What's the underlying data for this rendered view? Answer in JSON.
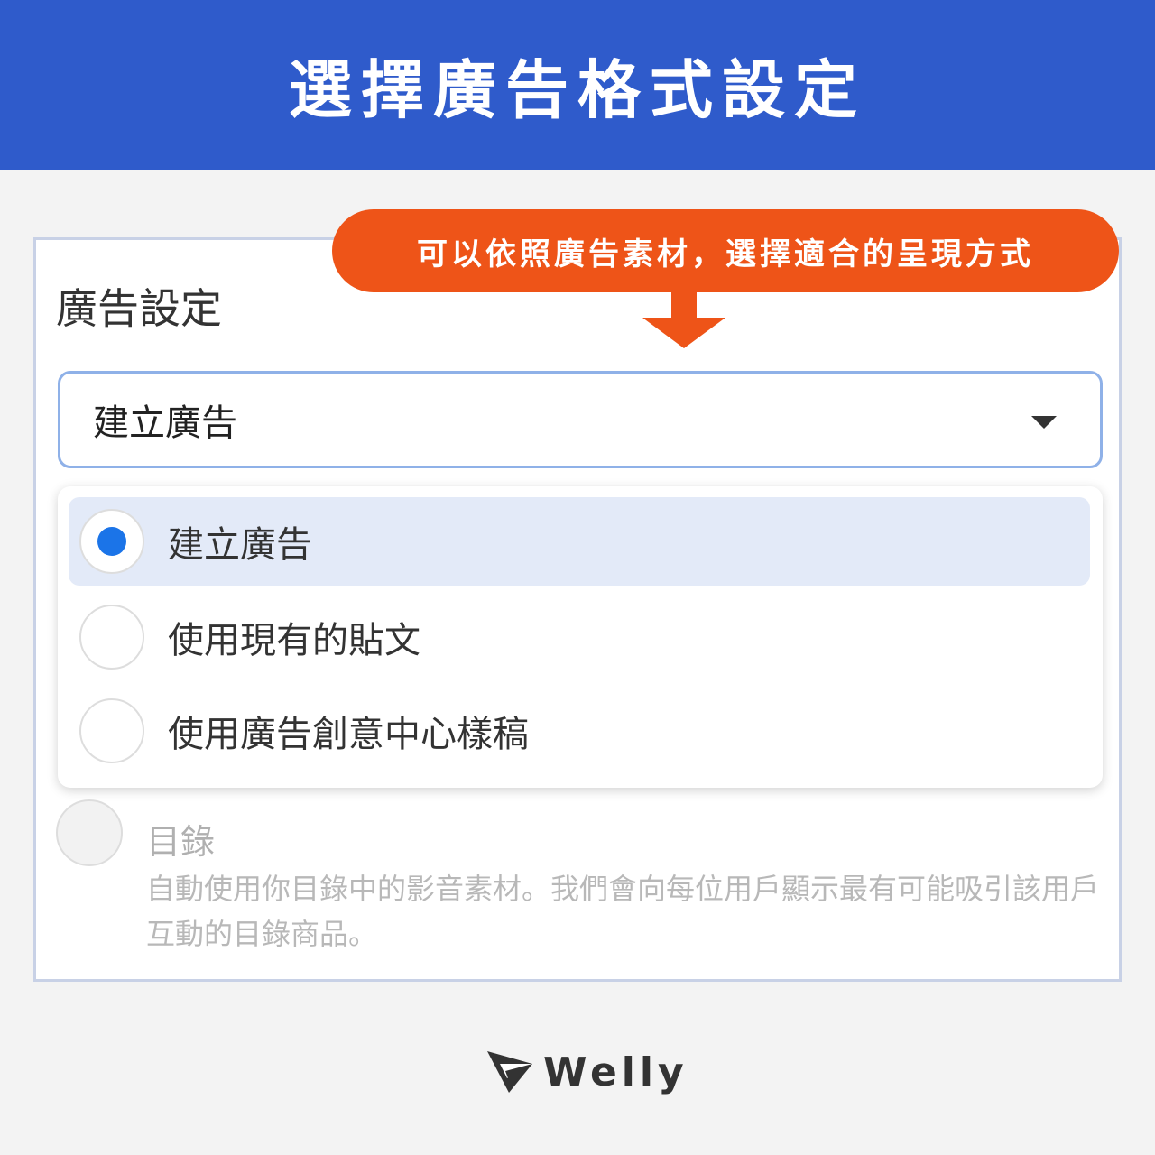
{
  "banner": {
    "title": "選擇廣告格式設定"
  },
  "callout": {
    "text": "可以依照廣告素材，選擇適合的呈現方式"
  },
  "ad_settings": {
    "title": "廣告設定",
    "select": {
      "value": "建立廣告",
      "caret_icon": "caret-down-icon"
    },
    "options": [
      {
        "label": "建立廣告",
        "selected": true
      },
      {
        "label": "使用現有的貼文",
        "selected": false
      },
      {
        "label": "使用廣告創意中心樣稿",
        "selected": false
      }
    ],
    "catalog": {
      "title": "目錄",
      "description": "自動使用你目錄中的影音素材。我們會向每位用戶顯示最有可能吸引該用戶互動的目錄商品。"
    }
  },
  "brand": {
    "name": "Welly",
    "logo_icon": "paper-plane-icon"
  },
  "colors": {
    "banner_bg": "#2f5bcb",
    "callout_bg": "#ee5418",
    "radio_selected": "#1b74e8",
    "option_selected_bg": "#e3eaf8"
  }
}
